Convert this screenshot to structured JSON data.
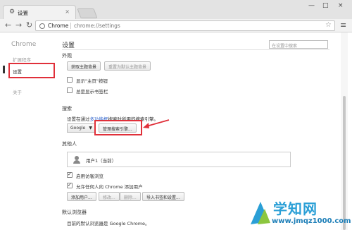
{
  "tab": {
    "title": "设置",
    "close": "×"
  },
  "window": {
    "minimize": "—",
    "maximize": "□",
    "close": "×"
  },
  "address": {
    "scheme": "Chrome",
    "path": "chrome://settings"
  },
  "sidebar": {
    "title": "Chrome",
    "items": [
      {
        "label": "扩展程序"
      },
      {
        "label": "设置"
      },
      {
        "label": "关于"
      }
    ]
  },
  "main": {
    "title": "设置",
    "search_placeholder": "在设置中搜索",
    "appearance": {
      "title": "外观",
      "get_themes": "获取主题背景",
      "reset_theme": "重置为默认主题背景",
      "show_home": "显示\"主页\"按钮",
      "show_bookmarks": "总是显示书签栏"
    },
    "search": {
      "title": "搜索",
      "desc_pre": "设置在通过",
      "desc_link": "多功能框",
      "desc_post": "搜索时所用的搜索引擎。",
      "engine": "Google",
      "manage": "管理搜索引擎..."
    },
    "people": {
      "title": "其他人",
      "user": "用户1（当前）",
      "guest": "启用访客浏览",
      "allow_add": "允许任何人向 Chrome 添加用户",
      "add_user": "添加用户...",
      "edit": "修改...",
      "delete": "删除...",
      "import": "导入书签和设置..."
    },
    "default_browser": {
      "title": "默认浏览器",
      "desc": "目前的默认浏览器是 Google Chrome。"
    }
  },
  "watermark": {
    "text": "学知网",
    "url": "www.jmqz1000.com"
  }
}
